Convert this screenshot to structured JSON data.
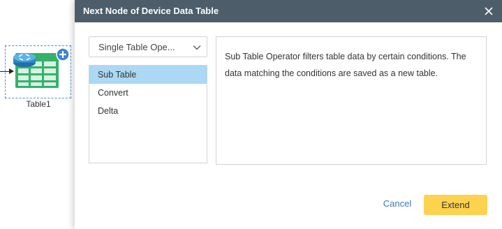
{
  "canvas": {
    "node_label": "Table1",
    "node_icon": "table-database-icon",
    "add_icon": "plus-icon"
  },
  "dialog": {
    "title": "Next Node of Device Data Table",
    "close_icon": "close-icon",
    "category_select": {
      "value": "Single Table Ope...",
      "icon": "chevron-down-icon"
    },
    "operators": [
      {
        "label": "Sub Table",
        "selected": true
      },
      {
        "label": "Convert",
        "selected": false
      },
      {
        "label": "Delta",
        "selected": false
      }
    ],
    "description": "Sub Table Operator filters table data by certain conditions. The data matching the conditions are saved as a new table.",
    "cancel_label": "Cancel",
    "extend_label": "Extend"
  },
  "colors": {
    "header_bg": "#4d5d6a",
    "selected_bg": "#abd8f4",
    "primary_button": "#fdd24f",
    "link": "#3a7ab8",
    "table_green": "#34b26a",
    "router_blue": "#3f9fd8"
  }
}
